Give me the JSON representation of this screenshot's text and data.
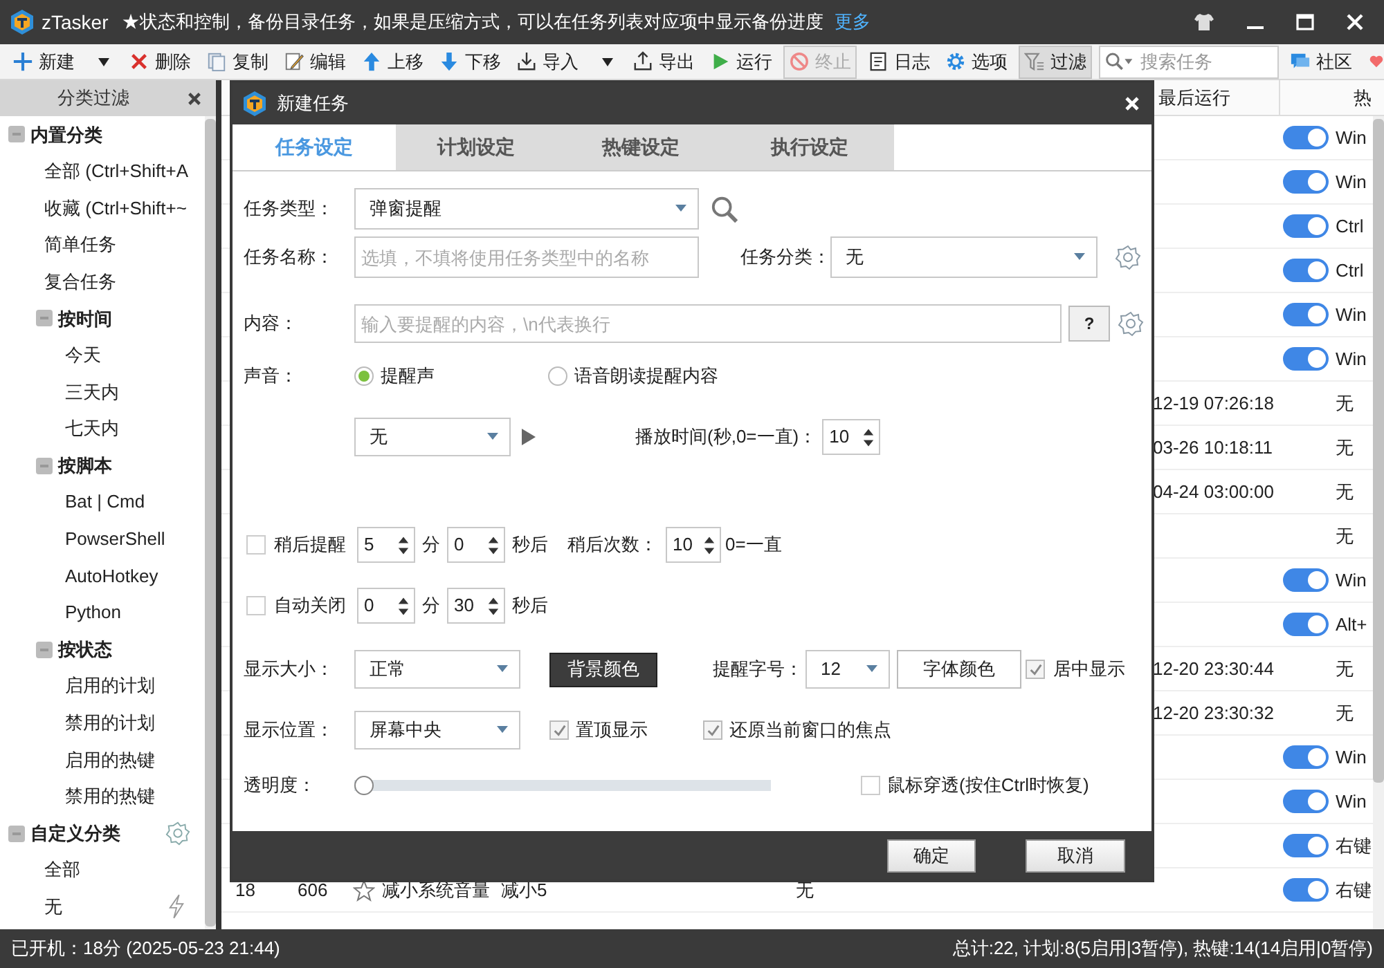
{
  "title_bar": {
    "app_name": "zTasker",
    "tip": "★状态和控制，备份目录任务，如果是压缩方式，可以在任务列表对应项中显示备份进度",
    "more_link": "更多"
  },
  "toolbar": {
    "items": [
      {
        "label": "新建",
        "has_menu": true,
        "disabled": false,
        "selected": false
      },
      {
        "label": "删除",
        "has_menu": false,
        "disabled": false,
        "selected": false
      },
      {
        "label": "复制",
        "has_menu": false,
        "disabled": false,
        "selected": false
      },
      {
        "label": "编辑",
        "has_menu": false,
        "disabled": false,
        "selected": false
      },
      {
        "label": "上移",
        "has_menu": false,
        "disabled": false,
        "selected": false
      },
      {
        "label": "下移",
        "has_menu": false,
        "disabled": false,
        "selected": false
      },
      {
        "label": "导入",
        "has_menu": true,
        "disabled": false,
        "selected": false
      },
      {
        "label": "导出",
        "has_menu": false,
        "disabled": false,
        "selected": false
      },
      {
        "label": "运行",
        "has_menu": false,
        "disabled": false,
        "selected": false
      },
      {
        "label": "终止",
        "has_menu": false,
        "disabled": true,
        "selected": false
      },
      {
        "label": "日志",
        "has_menu": false,
        "disabled": false,
        "selected": false
      },
      {
        "label": "选项",
        "has_menu": false,
        "disabled": false,
        "selected": false
      },
      {
        "label": "过滤",
        "has_menu": false,
        "disabled": false,
        "selected": true
      }
    ],
    "search": {
      "placeholder": "搜索任务"
    },
    "community": "社区"
  },
  "sidebar": {
    "title": "分类过滤",
    "tree": [
      {
        "label": "内置分类",
        "expanded": true,
        "children": [
          {
            "label": "全部 (Ctrl+Shift+A"
          },
          {
            "label": "收藏 (Ctrl+Shift+~"
          },
          {
            "label": "简单任务"
          },
          {
            "label": "复合任务"
          },
          {
            "label": "按时间",
            "expanded": true,
            "children": [
              {
                "label": "今天"
              },
              {
                "label": "三天内"
              },
              {
                "label": "七天内"
              }
            ]
          },
          {
            "label": "按脚本",
            "expanded": true,
            "children": [
              {
                "label": "Bat | Cmd"
              },
              {
                "label": "PowserShell"
              },
              {
                "label": "AutoHotkey"
              },
              {
                "label": "Python"
              }
            ]
          },
          {
            "label": "按状态",
            "expanded": true,
            "children": [
              {
                "label": "启用的计划"
              },
              {
                "label": "禁用的计划"
              },
              {
                "label": "启用的热键"
              },
              {
                "label": "禁用的热键"
              }
            ]
          }
        ]
      },
      {
        "label": "自定义分类",
        "expanded": true,
        "children": [
          {
            "label": "全部"
          },
          {
            "label": "无"
          }
        ]
      }
    ]
  },
  "table": {
    "columns": [
      "最后运行",
      "热"
    ],
    "rows": [
      {
        "hotkey_on": true,
        "hotkey": "Win"
      },
      {
        "hotkey_on": true,
        "hotkey": "Win"
      },
      {
        "hotkey_on": true,
        "hotkey": "Ctrl"
      },
      {
        "hotkey_on": true,
        "hotkey": "Ctrl"
      },
      {
        "hotkey_on": true,
        "hotkey": "Win"
      },
      {
        "hotkey_on": true,
        "hotkey": "Win"
      },
      {
        "last_run": "12-19 07:26:18",
        "hotkey": "无"
      },
      {
        "last_run": "03-26 10:18:11",
        "hotkey": "无"
      },
      {
        "last_run": "04-24 03:00:00",
        "hotkey": "无"
      },
      {
        "hotkey": "无"
      },
      {
        "hotkey_on": true,
        "hotkey": "Win"
      },
      {
        "hotkey_on": true,
        "hotkey": "Alt+"
      },
      {
        "last_run": "12-20 23:30:44",
        "hotkey": "无"
      },
      {
        "last_run": "12-20 23:30:32",
        "hotkey": "无"
      },
      {
        "hotkey_on": true,
        "hotkey": "Win"
      },
      {
        "hotkey_on": true,
        "hotkey": "Win"
      },
      {
        "hotkey_on": true,
        "hotkey": "右键"
      },
      {
        "id": "18",
        "number": "606",
        "starred": false,
        "name": "减小系统音量",
        "description": "减小5",
        "schedule": "无",
        "hotkey_on": true,
        "hotkey": "右键"
      }
    ]
  },
  "dialog": {
    "title": "新建任务",
    "tabs": [
      {
        "label": "任务设定",
        "selected": true
      },
      {
        "label": "计划设定",
        "selected": false
      },
      {
        "label": "热键设定",
        "selected": false
      },
      {
        "label": "执行设定",
        "selected": false
      }
    ],
    "task_type": {
      "label": "任务类型：",
      "value": "弹窗提醒"
    },
    "task_name": {
      "label": "任务名称：",
      "placeholder": "选填，不填将使用任务类型中的名称"
    },
    "category": {
      "label": "任务分类：",
      "value": "无"
    },
    "content": {
      "label": "内容：",
      "placeholder": "输入要提醒的内容，\\n代表换行",
      "help_button": "?"
    },
    "sound": {
      "label": "声音：",
      "options": [
        {
          "label": "提醒声",
          "selected": true
        },
        {
          "label": "语音朗读提醒内容",
          "selected": false
        }
      ],
      "sound_file": "无",
      "duration_label": "播放时间(秒,0=一直)：",
      "duration": "10"
    },
    "snooze": {
      "label": "稍后提醒",
      "checked": false,
      "minutes": "5",
      "minutes_unit": "分",
      "seconds": "0",
      "seconds_unit": "秒后",
      "count_label": "稍后次数：",
      "count": "10",
      "count_hint": "0=一直"
    },
    "auto_close": {
      "label": "自动关闭",
      "checked": false,
      "minutes": "0",
      "minutes_unit": "分",
      "seconds": "30",
      "seconds_unit": "秒后"
    },
    "display_size": {
      "label": "显示大小：",
      "value": "正常",
      "bg_color_button": "背景颜色",
      "font_size_label": "提醒字号：",
      "font_size": "12",
      "font_color_button": "字体颜色",
      "center": {
        "label": "居中显示",
        "checked": true
      }
    },
    "position": {
      "label": "显示位置：",
      "value": "屏幕中央",
      "options": [
        {
          "label": "置顶显示",
          "checked": true
        },
        {
          "label": "还原当前窗口的焦点",
          "checked": true
        }
      ]
    },
    "opacity": {
      "label": "透明度：",
      "level": 0,
      "click_through": {
        "label": "鼠标穿透(按住Ctrl时恢复)",
        "checked": false
      }
    },
    "buttons": [
      "确定",
      "取消"
    ]
  },
  "status_bar": {
    "uptime": "已开机：18分 (2025-05-23 21:44)",
    "summary": "总计:22, 计划:8(5启用|3暂停), 热键:14(14启用|0暂停)"
  }
}
